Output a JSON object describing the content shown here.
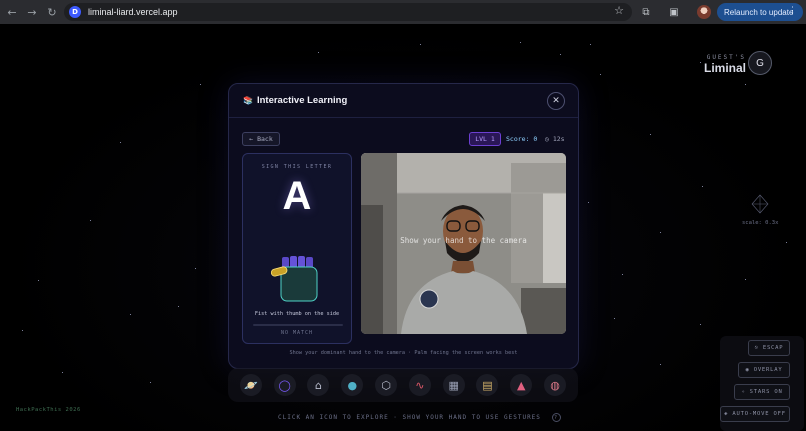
{
  "browser": {
    "url": "liminal-liard.vercel.app",
    "site_icon": "D",
    "relaunch_label": "Relaunch to update",
    "menu_dots": "⋮"
  },
  "header": {
    "guest_label": "GUEST'S",
    "brand": "Liminal",
    "avatar_initial": "G"
  },
  "scale_label": "scale: 0.3x",
  "modal": {
    "title": "Interactive Learning",
    "close_glyph": "✕",
    "back_label": "← Back",
    "level": "LVL 1",
    "score": "Score: 0",
    "timer": "◷ 12s",
    "sign_label": "SIGN THIS LETTER",
    "letter": "A",
    "hand_hint": "Fist with thumb on the side",
    "match_label": "NO MATCH",
    "match_progress": 0,
    "camera_prompt": "Show your hand to the camera",
    "instruction": "Show your dominant hand to the camera · Palm facing the screen works best"
  },
  "dock": {
    "items": [
      "planet-icon",
      "ring-icon",
      "home-icon",
      "globe-icon",
      "cube-icon",
      "pulse-icon",
      "game-icon",
      "book-icon",
      "rocket-icon",
      "brain-icon"
    ]
  },
  "controls": {
    "escape": "⎋ ESCAP",
    "overlay": "◉ OVERLAY",
    "stars": "✧ STARS ON",
    "auto_move": "◈ AUTO-MOVE OFF"
  },
  "footer": {
    "copyright": "HackPackThis 2026",
    "hint": "CLICK AN ICON TO EXPLORE · SHOW YOUR HAND TO USE GESTURES",
    "help": "?"
  },
  "colors": {
    "accent": "#7c5cff",
    "relaunch": "#1d4f91",
    "modal_bg": "#0c0c1e"
  }
}
